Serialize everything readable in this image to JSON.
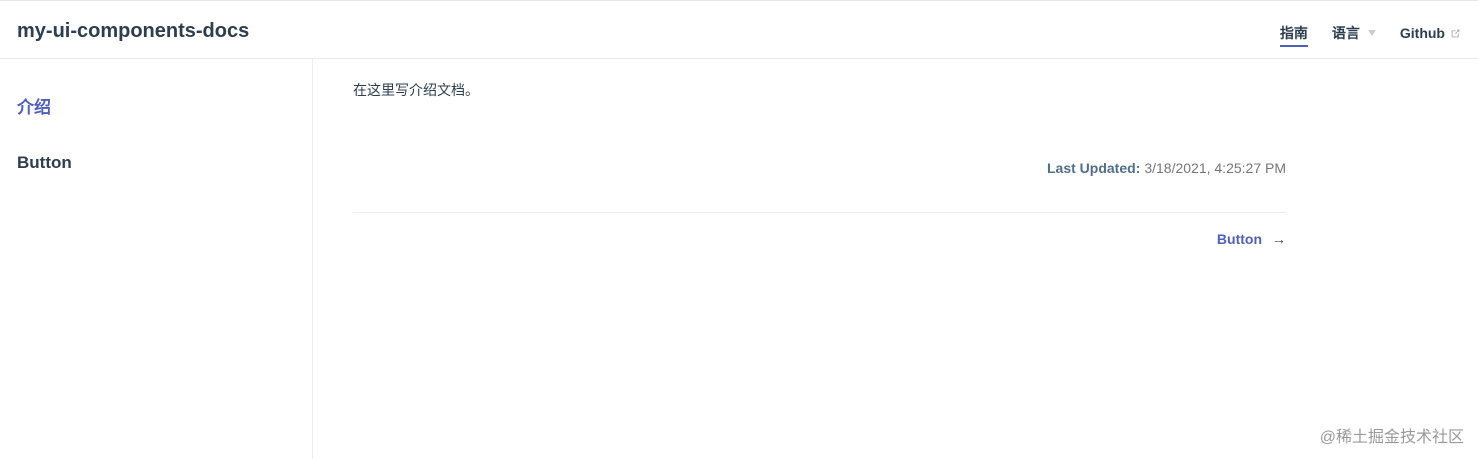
{
  "header": {
    "site_title": "my-ui-components-docs",
    "nav": [
      {
        "label": "指南",
        "active": true
      },
      {
        "label": "语言",
        "dropdown": true
      },
      {
        "label": "Github",
        "external": true
      }
    ],
    "icons": {
      "dropdown": "chevron-down-icon",
      "external": "external-link-icon"
    }
  },
  "sidebar": {
    "items": [
      {
        "label": "介绍",
        "active": true
      },
      {
        "label": "Button",
        "active": false
      }
    ]
  },
  "content": {
    "intro": "在这里写介绍文档。",
    "last_updated_label": "Last Updated:",
    "last_updated_value": "3/18/2021, 4:25:27 PM",
    "next_link": "Button",
    "next_arrow": "→"
  },
  "watermark": "@稀土掘金技术社区",
  "colors": {
    "accent": "#4f5fbf",
    "text": "#2c3e50",
    "border": "#eaecef"
  }
}
